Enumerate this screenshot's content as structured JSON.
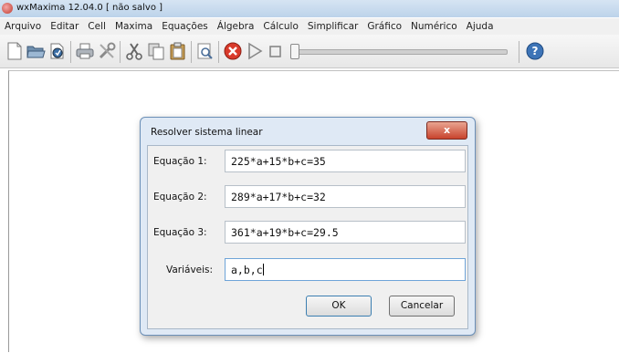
{
  "window": {
    "title": "wxMaxima 12.04.0 [ não salvo ]"
  },
  "menubar": {
    "items": [
      "Arquivo",
      "Editar",
      "Cell",
      "Maxima",
      "Equações",
      "Álgebra",
      "Cálculo",
      "Simplificar",
      "Gráfico",
      "Numérico",
      "Ajuda"
    ]
  },
  "toolbar": {
    "icons": [
      "new-file-icon",
      "open-folder-icon",
      "save-icon",
      "print-icon",
      "preferences-icon",
      "cut-icon",
      "copy-icon",
      "paste-icon",
      "find-icon",
      "interrupt-icon",
      "play-icon",
      "stop-icon",
      "animation-slider",
      "help-icon"
    ]
  },
  "dialog": {
    "title": "Resolver sistema linear",
    "close_label": "x",
    "fields": [
      {
        "label": "Equação 1:",
        "value": "225*a+15*b+c=35"
      },
      {
        "label": "Equação 2:",
        "value": "289*a+17*b+c=32"
      },
      {
        "label": "Equação 3:",
        "value": "361*a+19*b+c=29.5"
      },
      {
        "label": "Variáveis:",
        "value": "a,b,c"
      }
    ],
    "ok_label": "OK",
    "cancel_label": "Cancelar"
  },
  "colors": {
    "titlebar": "#c8dcf0",
    "dialog_frame": "#dfe9f5",
    "close_button": "#c8432d",
    "interrupt_icon": "#d93a2b"
  }
}
